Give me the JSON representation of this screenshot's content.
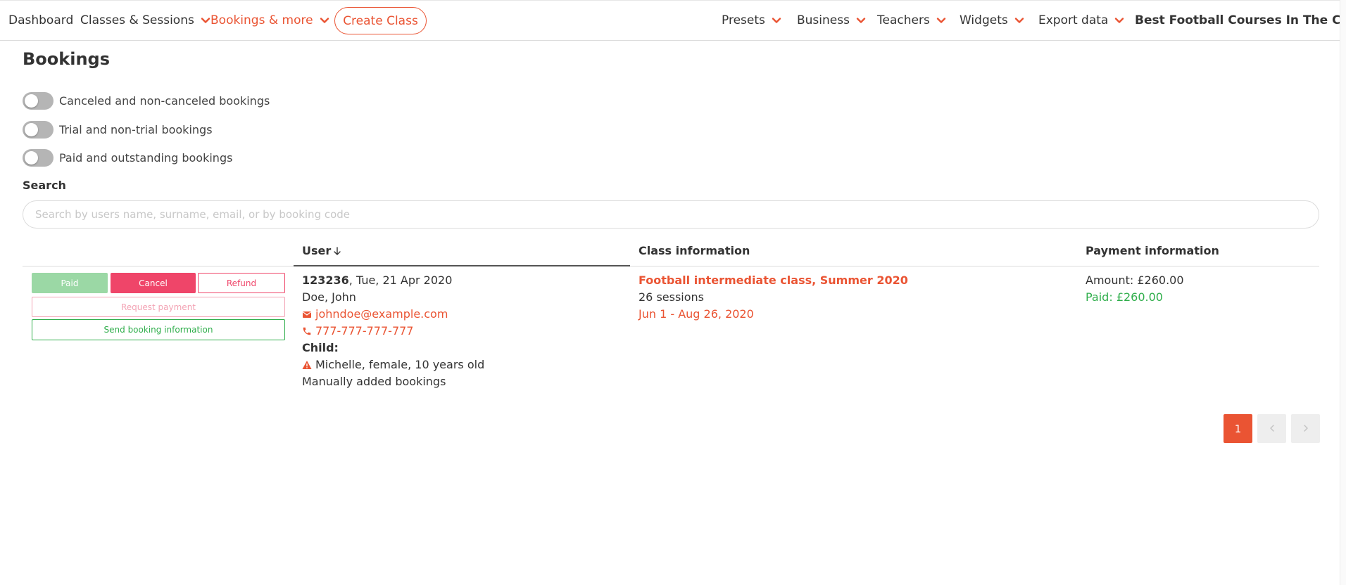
{
  "nav": {
    "left": [
      {
        "label": "Dashboard",
        "has_dropdown": false,
        "active": false
      },
      {
        "label": "Classes & Sessions",
        "has_dropdown": true,
        "active": false
      },
      {
        "label": "Bookings & more",
        "has_dropdown": true,
        "active": true
      }
    ],
    "create_button": "Create Class",
    "right": [
      {
        "label": "Presets",
        "has_dropdown": true
      },
      {
        "label": "Business",
        "has_dropdown": true
      },
      {
        "label": "Teachers",
        "has_dropdown": true
      },
      {
        "label": "Widgets",
        "has_dropdown": true
      },
      {
        "label": "Export data",
        "has_dropdown": true
      },
      {
        "label": "Best Football Courses In The City",
        "has_dropdown": true
      }
    ]
  },
  "page": {
    "title": "Bookings"
  },
  "filters": [
    {
      "label": "Canceled and non-canceled bookings",
      "on": false
    },
    {
      "label": "Trial and non-trial bookings",
      "on": false
    },
    {
      "label": "Paid and outstanding bookings",
      "on": false
    }
  ],
  "search": {
    "label": "Search",
    "placeholder": "Search by users name, surname, email, or by booking code",
    "value": ""
  },
  "table": {
    "headers": {
      "user": "User",
      "class_info": "Class information",
      "payment_info": "Payment information"
    },
    "sort": {
      "column": "user",
      "direction": "descending",
      "icon": "arrow-down-icon"
    },
    "rows": [
      {
        "actions": {
          "paid": "Paid",
          "cancel": "Cancel",
          "refund": "Refund",
          "request_payment": "Request payment",
          "send_info": "Send booking information"
        },
        "user": {
          "booking_code": "123236",
          "date": ", Tue, 21 Apr 2020",
          "name": "Doe, John",
          "email": "johndoe@example.com",
          "phone": "777-777-777-777",
          "child_label": "Child:",
          "child": "Michelle, female, 10 years old",
          "note": "Manually added bookings"
        },
        "class": {
          "name": "Football intermediate class, Summer 2020",
          "sessions": "26 sessions",
          "dates": "Jun 1 - Aug 26, 2020"
        },
        "payment": {
          "amount": "Amount: £260.00",
          "paid": "Paid: £260.00"
        }
      }
    ]
  },
  "pagination": {
    "current": "1"
  },
  "colors": {
    "accent": "#ea5433",
    "paid_green": "#2fae4b",
    "paid_button": "#9bd8a5",
    "cancel_pink": "#ef4569",
    "toggle_off": "#b5b5b5"
  }
}
